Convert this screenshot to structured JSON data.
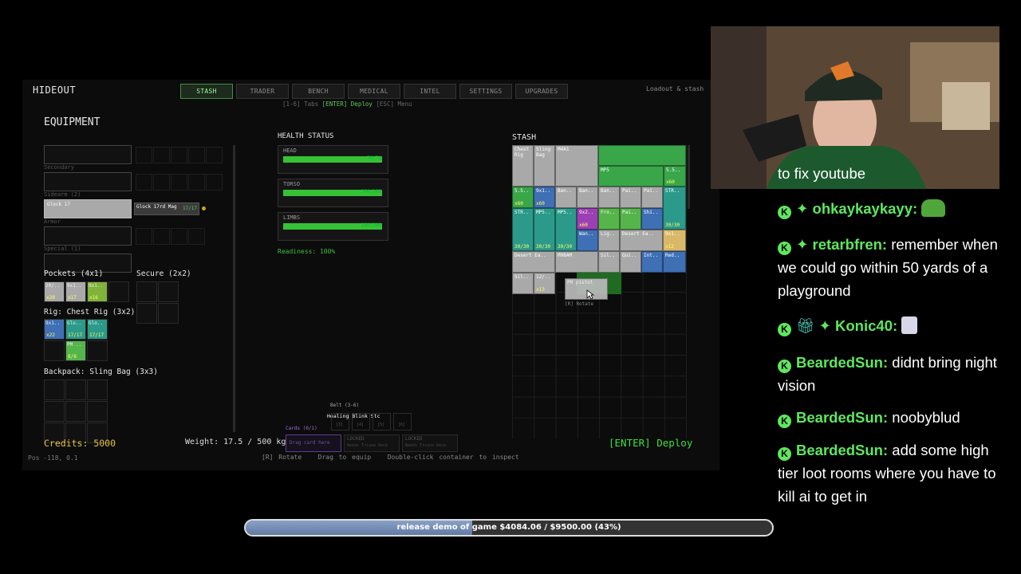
{
  "game": {
    "title": "HIDEOUT",
    "tabs": [
      "STASH",
      "TRADER",
      "BENCH",
      "MEDICAL",
      "INTEL",
      "SETTINGS",
      "UPGRADES"
    ],
    "active_tab": "STASH",
    "hint_pre": "[1-6] Tabs",
    "hint_enter": "[ENTER] Deploy",
    "hint_post": "[ESC] Menu",
    "top_right": "Loadout & stash",
    "equipment": {
      "heading": "EQUIPMENT",
      "slot_labels": [
        "Secondary",
        "Sidearm (2)",
        "Armor",
        "Special (1)"
      ],
      "sidearm_item": "Glock 17",
      "ammo_item": "Glock 17rd Mag",
      "ammo_count": "17/17",
      "pockets_label": "Pockets (4x1)",
      "pockets_items": [
        {
          "label": "20/..",
          "qty": "x20"
        },
        {
          "label": "9x1..",
          "qty": "x17"
        },
        {
          "label": "9x1..",
          "qty": "x16"
        }
      ],
      "secure_label": "Secure (2x2)",
      "rig_label": "Rig: Chest Rig (3x2)",
      "rig_items": [
        {
          "label": "9x1..",
          "qty": "x22"
        },
        {
          "label": "Glo..",
          "qty": "17/17"
        },
        {
          "label": "Glo..",
          "qty": "17/17"
        },
        {
          "label": "PM ..",
          "qty": "8/8"
        }
      ],
      "backpack_label": "Backpack: Sling Bag (3x3)",
      "credits": "Credits: 5000",
      "pos": "Pos -118, 0.1"
    },
    "health": {
      "heading": "HEALTH STATUS",
      "parts": [
        {
          "name": "HEAD",
          "value": "70/70",
          "fraction": 1.0
        },
        {
          "name": "TORSO",
          "value": "200/200",
          "fraction": 1.0
        },
        {
          "name": "LIMBS",
          "value": "180/180",
          "fraction": 1.0
        }
      ],
      "readiness": "Readiness: 100%"
    },
    "weight": "Weight: 17.5 / 500 kg",
    "belt": {
      "label": "Belt (3-6)",
      "item": "Healing Blink Stc",
      "slots": [
        "[3]",
        "[4]",
        "[5]",
        "[6]"
      ]
    },
    "cards": {
      "label": "Cards (0/1)",
      "drop": "Drag card here",
      "locked": "LOCKED",
      "locked_sub": "Needs Triune Deck"
    },
    "footer": {
      "rotate": "[R] Rotate",
      "drag": "Drag to equip",
      "dbl": "Double-click container to inspect"
    },
    "stash": {
      "heading": "STASH",
      "rotate_tip": "[R] Rotate",
      "items": [
        {
          "label": "Chest Rig",
          "qty": "",
          "color": "#a9a9a9"
        },
        {
          "label": "Sling Bag",
          "qty": "",
          "color": "#a9a9a9"
        },
        {
          "label": "M4A1",
          "qty": "",
          "color": "#3aa64a"
        },
        {
          "label": "MP5",
          "qty": "",
          "color": "#3aa64a"
        },
        {
          "label": "5.5..",
          "qty": "x60",
          "color": "#3aa64a"
        },
        {
          "label": "5.5..",
          "qty": "x60",
          "color": "#3aa64a"
        },
        {
          "label": "9x1..",
          "qty": "x60",
          "color": "#3f6fb5"
        },
        {
          "label": "Ban..",
          "qty": "",
          "color": "#a9a9a9"
        },
        {
          "label": "Ban..",
          "qty": "",
          "color": "#a9a9a9"
        },
        {
          "label": "Ban..",
          "qty": "",
          "color": "#a9a9a9"
        },
        {
          "label": "Pai..",
          "qty": "",
          "color": "#a9a9a9"
        },
        {
          "label": "Pai..",
          "qty": "",
          "color": "#a9a9a9"
        },
        {
          "label": "STR..",
          "qty": "30/30",
          "color": "#2b9a8a"
        },
        {
          "label": "STR..",
          "qty": "30/30",
          "color": "#2b9a8a"
        },
        {
          "label": "MP5..",
          "qty": "30/30",
          "color": "#2b9a8a"
        },
        {
          "label": "MP5..",
          "qty": "30/30",
          "color": "#2b9a8a"
        },
        {
          "label": "9x2..",
          "qty": "x60",
          "color": "#9c3fb5"
        },
        {
          "label": "Fro..",
          "qty": "",
          "color": "#55b54a"
        },
        {
          "label": "Pai..",
          "qty": "",
          "color": "#55b54a"
        },
        {
          "label": "Shi..",
          "qty": "",
          "color": "#3f6fb5"
        },
        {
          "label": "Wan..",
          "qty": "",
          "color": "#3f6fb5"
        },
        {
          "label": "Lig..",
          "qty": "",
          "color": "#a9a9a9"
        },
        {
          "label": "Desert Ea..",
          "qty": "",
          "color": "#a9a9a9"
        },
        {
          "label": "9x1..",
          "qty": "x12",
          "color": "#d9b86a"
        },
        {
          "label": "Desert Ea..",
          "qty": "",
          "color": "#a9a9a9"
        },
        {
          "label": "M9BAM",
          "qty": "",
          "color": "#a9a9a9"
        },
        {
          "label": "Sil..",
          "qty": "",
          "color": "#a9a9a9"
        },
        {
          "label": "Qui..",
          "qty": "",
          "color": "#a9a9a9"
        },
        {
          "label": "Int..",
          "qty": "",
          "color": "#3f6fb5"
        },
        {
          "label": "Red..",
          "qty": "",
          "color": "#3f6fb5"
        },
        {
          "label": "Sil..",
          "qty": "",
          "color": "#a9a9a9"
        },
        {
          "label": "12/..",
          "qty": "x13",
          "color": "#a9a9a9"
        },
        {
          "label": "PM pistol",
          "qty": "",
          "color": "#bbbbbb"
        }
      ]
    },
    "deploy": "[ENTER] Deploy"
  },
  "stream": {
    "chat": [
      {
        "user": "",
        "text": "to fix youtube"
      },
      {
        "user": "ohkaykaykayy:",
        "text": ""
      },
      {
        "user": "retarbfren:",
        "text": "remember when we could go within 50 yards of a playground"
      },
      {
        "user": "Konic40:",
        "text": ""
      },
      {
        "user": "BeardedSun:",
        "text": "didnt bring night vision"
      },
      {
        "user": "BeardedSun:",
        "text": "noobyblud"
      },
      {
        "user": "BeardedSun:",
        "text": "add some high tier loot rooms where you have to kill ai to get in"
      }
    ],
    "goal_text": "release demo of game $4084.06 / $9500.00 (43%)",
    "goal_fraction": 0.43
  }
}
